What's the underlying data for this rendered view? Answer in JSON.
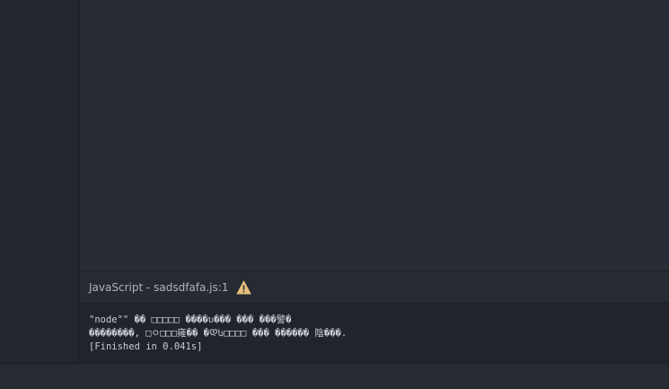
{
  "panel": {
    "title": "JavaScript - sadsdfafa.js:1",
    "warning_icon": "warning-triangle-icon",
    "warning_color": "#e5c07b"
  },
  "output": {
    "lines": [
      "\"node\"\" �� □□□□□ ����ʋ��� ��� ���警�",
      "��������, □ㅇ□□□雍�� �ᲓᲡ□□□□ ��� ������ 陰���.",
      "[Finished in 0.041s]"
    ]
  }
}
